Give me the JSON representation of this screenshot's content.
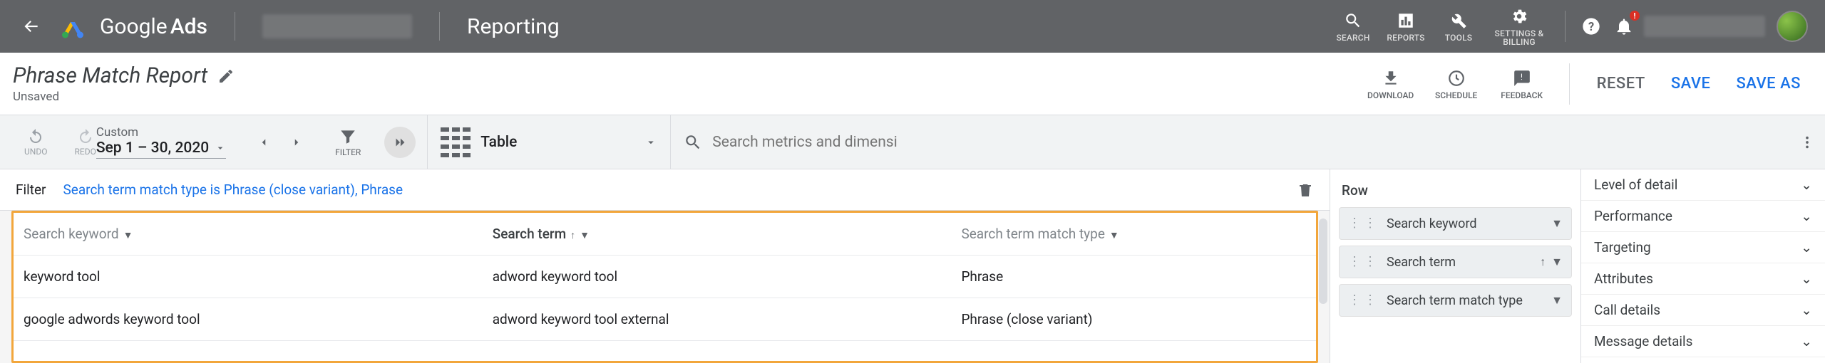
{
  "header": {
    "brand_a": "Google",
    "brand_b": "Ads",
    "breadcrumb": "Reporting",
    "tools": {
      "search": "SEARCH",
      "reports": "REPORTS",
      "tools": "TOOLS",
      "settings_a": "SETTINGS &",
      "settings_b": "BILLING"
    }
  },
  "title": {
    "report_name": "Phrase Match Report",
    "status": "Unsaved",
    "actions": {
      "download": "DOWNLOAD",
      "schedule": "SCHEDULE",
      "feedback": "FEEDBACK",
      "reset": "RESET",
      "save": "SAVE",
      "save_as": "SAVE AS"
    }
  },
  "strip": {
    "undo": "UNDO",
    "redo": "REDO",
    "date_mode": "Custom",
    "date_range": "Sep 1 – 30, 2020",
    "filter": "FILTER",
    "viz_type": "Table",
    "search_placeholder": "Search metrics and dimensions"
  },
  "filter_bar": {
    "label": "Filter",
    "chip": "Search term match type is Phrase (close variant), Phrase"
  },
  "columns": {
    "c0": "Search keyword",
    "c1": "Search term",
    "c2": "Search term match type"
  },
  "rows": [
    {
      "c0": "keyword tool",
      "c1": "adword keyword tool",
      "c2": "Phrase"
    },
    {
      "c0": "google adwords keyword tool",
      "c1": "adword keyword tool external",
      "c2": "Phrase (close variant)"
    }
  ],
  "row_panel": {
    "heading": "Row",
    "pills": {
      "p0": "Search keyword",
      "p1": "Search term",
      "p2": "Search term match type"
    }
  },
  "detail_panel": {
    "d0": "Level of detail",
    "d1": "Performance",
    "d2": "Targeting",
    "d3": "Attributes",
    "d4": "Call details",
    "d5": "Message details"
  }
}
